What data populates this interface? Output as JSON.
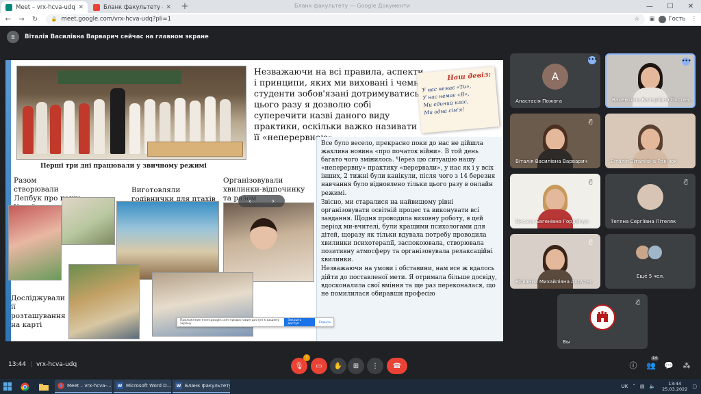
{
  "browser": {
    "tabs": [
      {
        "title": "Meet – vrx-hcva-udq",
        "icon_color": "#00897b",
        "active": true
      },
      {
        "title": "Бланк факультету - clg-edu@clp",
        "icon_color": "#ea4335",
        "active": false
      }
    ],
    "new_tab_symbol": "+",
    "window_title": "Бланк факультету — Google Документи",
    "url": "meet.google.com/vrx-hcva-udq?pli=1",
    "guest_label": "Гость"
  },
  "banner": {
    "text": "Віталія Василівна Варварич сейчас на главном экране"
  },
  "slide": {
    "caption_1": "Перші три дні працювали у звичному режимі",
    "heading": "Незважаючи на всі правила, аспекти і принципи, яких ми виховані і чемні студенти зобов'язані дотримуватись, цього разу я дозволю собі суперечити назві даного виду практики, оскільки важко називати її «неперервною»",
    "note": {
      "title": "Наш девіз:",
      "lines": [
        "У нас немає «Ти»,",
        "У нас немає «Я»,",
        "Ми єдиний клас,",
        "Ми одна сім'я!"
      ]
    },
    "body": [
      "Все було весело, прекрасно поки до нас не дійшла жахлива новина «про початок війни». В той день багато чого змінилось. Через цю ситуацію нашу «неперервну» практику «перервали», у нас як і у всіх інших, 2 тижні були канікули, після чого з 14 березня навчання було відновлено тільки цього разу в онлайн режимі.",
      "Звісно, ми старалися на найвищому рівні організовувати освітній процес та виконувати всі завдання. Щодня проводила виховну роботу, в цей період ми-вчителі, були кращими психологами для дітей, щоразу як тільки вдувала потребу проводила хвилинки психотерапії, заспокоювала, створювала позитивну атмосферу та організовувала релаксаційні хвилинки.",
      "Незважаючи на умови і обставини, нам все ж вдалось дійти до поставленої мети. Я отримала більше досвіду, вдосконалила свої вміння та ще раз переконалася, що не помилилася обиравши професію"
    ],
    "labels": {
      "lapbook": "Разом створювали Лепбук про нашу Україну",
      "clocks": "Виготовляли годівнички для птахів",
      "rest": "Організовували хвилинки-відпочинку та разом насолоджувались смаколиками",
      "map": "Досліджували її розташування на карті"
    },
    "toast": {
      "text": "Приложение meet.google.com предоставил доступ к вашему экрану.",
      "button": "Закрыть доступ",
      "hide": "Скрыть"
    },
    "controls": {
      "prev": "‹",
      "next": "›"
    }
  },
  "participants": [
    {
      "name": "Анастасія Пожога",
      "avatar_letter": "A",
      "avatar_color": "#8d6e63",
      "type": "avatar",
      "menu": true
    },
    {
      "name": "Валентина Валеріївна Постев...",
      "type": "video",
      "bg": "#c9c6c2",
      "hair": "#1e1511",
      "torso": "#e9e6e2",
      "active": true,
      "menu": true
    },
    {
      "name": "Віталія Василівна Варварич",
      "type": "video",
      "bg": "#6b5b4c",
      "hair": "#4a3020",
      "torso": "#2e2a28",
      "mic_off": true
    },
    {
      "name": "Віталія Віталіївна Ракнюк",
      "type": "video",
      "bg": "#d9c8b8",
      "hair": "#5a4030",
      "torso": "#d4b9a5",
      "mic_off": false
    },
    {
      "name": "Оксана Євгенівна Гордійчук",
      "type": "video",
      "bg": "#f0efe9",
      "hair": "#c79a5a",
      "torso": "#b73636",
      "mic_off": true
    },
    {
      "name": "Тетяна Сергіївна Пітеляк",
      "avatar_color": "#d7c4b4",
      "type": "photo-avatar",
      "mic_off": true
    },
    {
      "name": "Юліанна Михайлівна Апрутес",
      "type": "video",
      "bg": "#d8cfc8",
      "hair": "#3a2418",
      "torso": "#5a4a3e",
      "mic_off": true
    },
    {
      "name": "Ещё 5 чел.",
      "type": "more"
    },
    {
      "name": "Вы",
      "type": "self",
      "mic_off": true
    }
  ],
  "meetbar": {
    "time": "13:44",
    "code": "vrx-hcva-udq",
    "participant_count": "14",
    "badge": "!"
  },
  "taskbar": {
    "tasks": [
      {
        "label": "Meet – vrx-hcva-...",
        "icon": "chrome"
      },
      {
        "label": "Microsoft Word D...",
        "icon": "word"
      },
      {
        "label": "Бланк факультету...",
        "icon": "word"
      }
    ],
    "lang": "UK",
    "time": "13:44",
    "date": "25.03.2022"
  }
}
